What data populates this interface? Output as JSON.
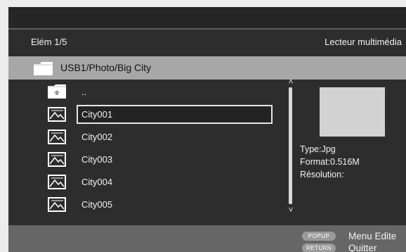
{
  "header": {
    "item_counter": "Elém 1/5",
    "title": "Lecteur multimédia"
  },
  "path_bar": {
    "path": "USB1/Photo/Big City"
  },
  "file_list": {
    "items": [
      {
        "label": "..",
        "icon": "folder-up-icon"
      },
      {
        "label": "City001",
        "icon": "image-file-icon",
        "selected": true
      },
      {
        "label": "City002",
        "icon": "image-file-icon"
      },
      {
        "label": "City003",
        "icon": "image-file-icon"
      },
      {
        "label": "City004",
        "icon": "image-file-icon"
      },
      {
        "label": "City005",
        "icon": "image-file-icon"
      }
    ]
  },
  "info_panel": {
    "type": "Type:Jpg",
    "format": "Format:0.516M",
    "resolution": "Résolution:"
  },
  "footer": {
    "popup_key": "POPUP",
    "popup_label": "Menu Edite",
    "return_key": "RETURN",
    "return_label": "Quitter"
  },
  "colors": {
    "background": "#2d2d2d",
    "path_bar": "#a7a7a7",
    "footer": "#666666",
    "selection_border": "#e6e6e6"
  }
}
